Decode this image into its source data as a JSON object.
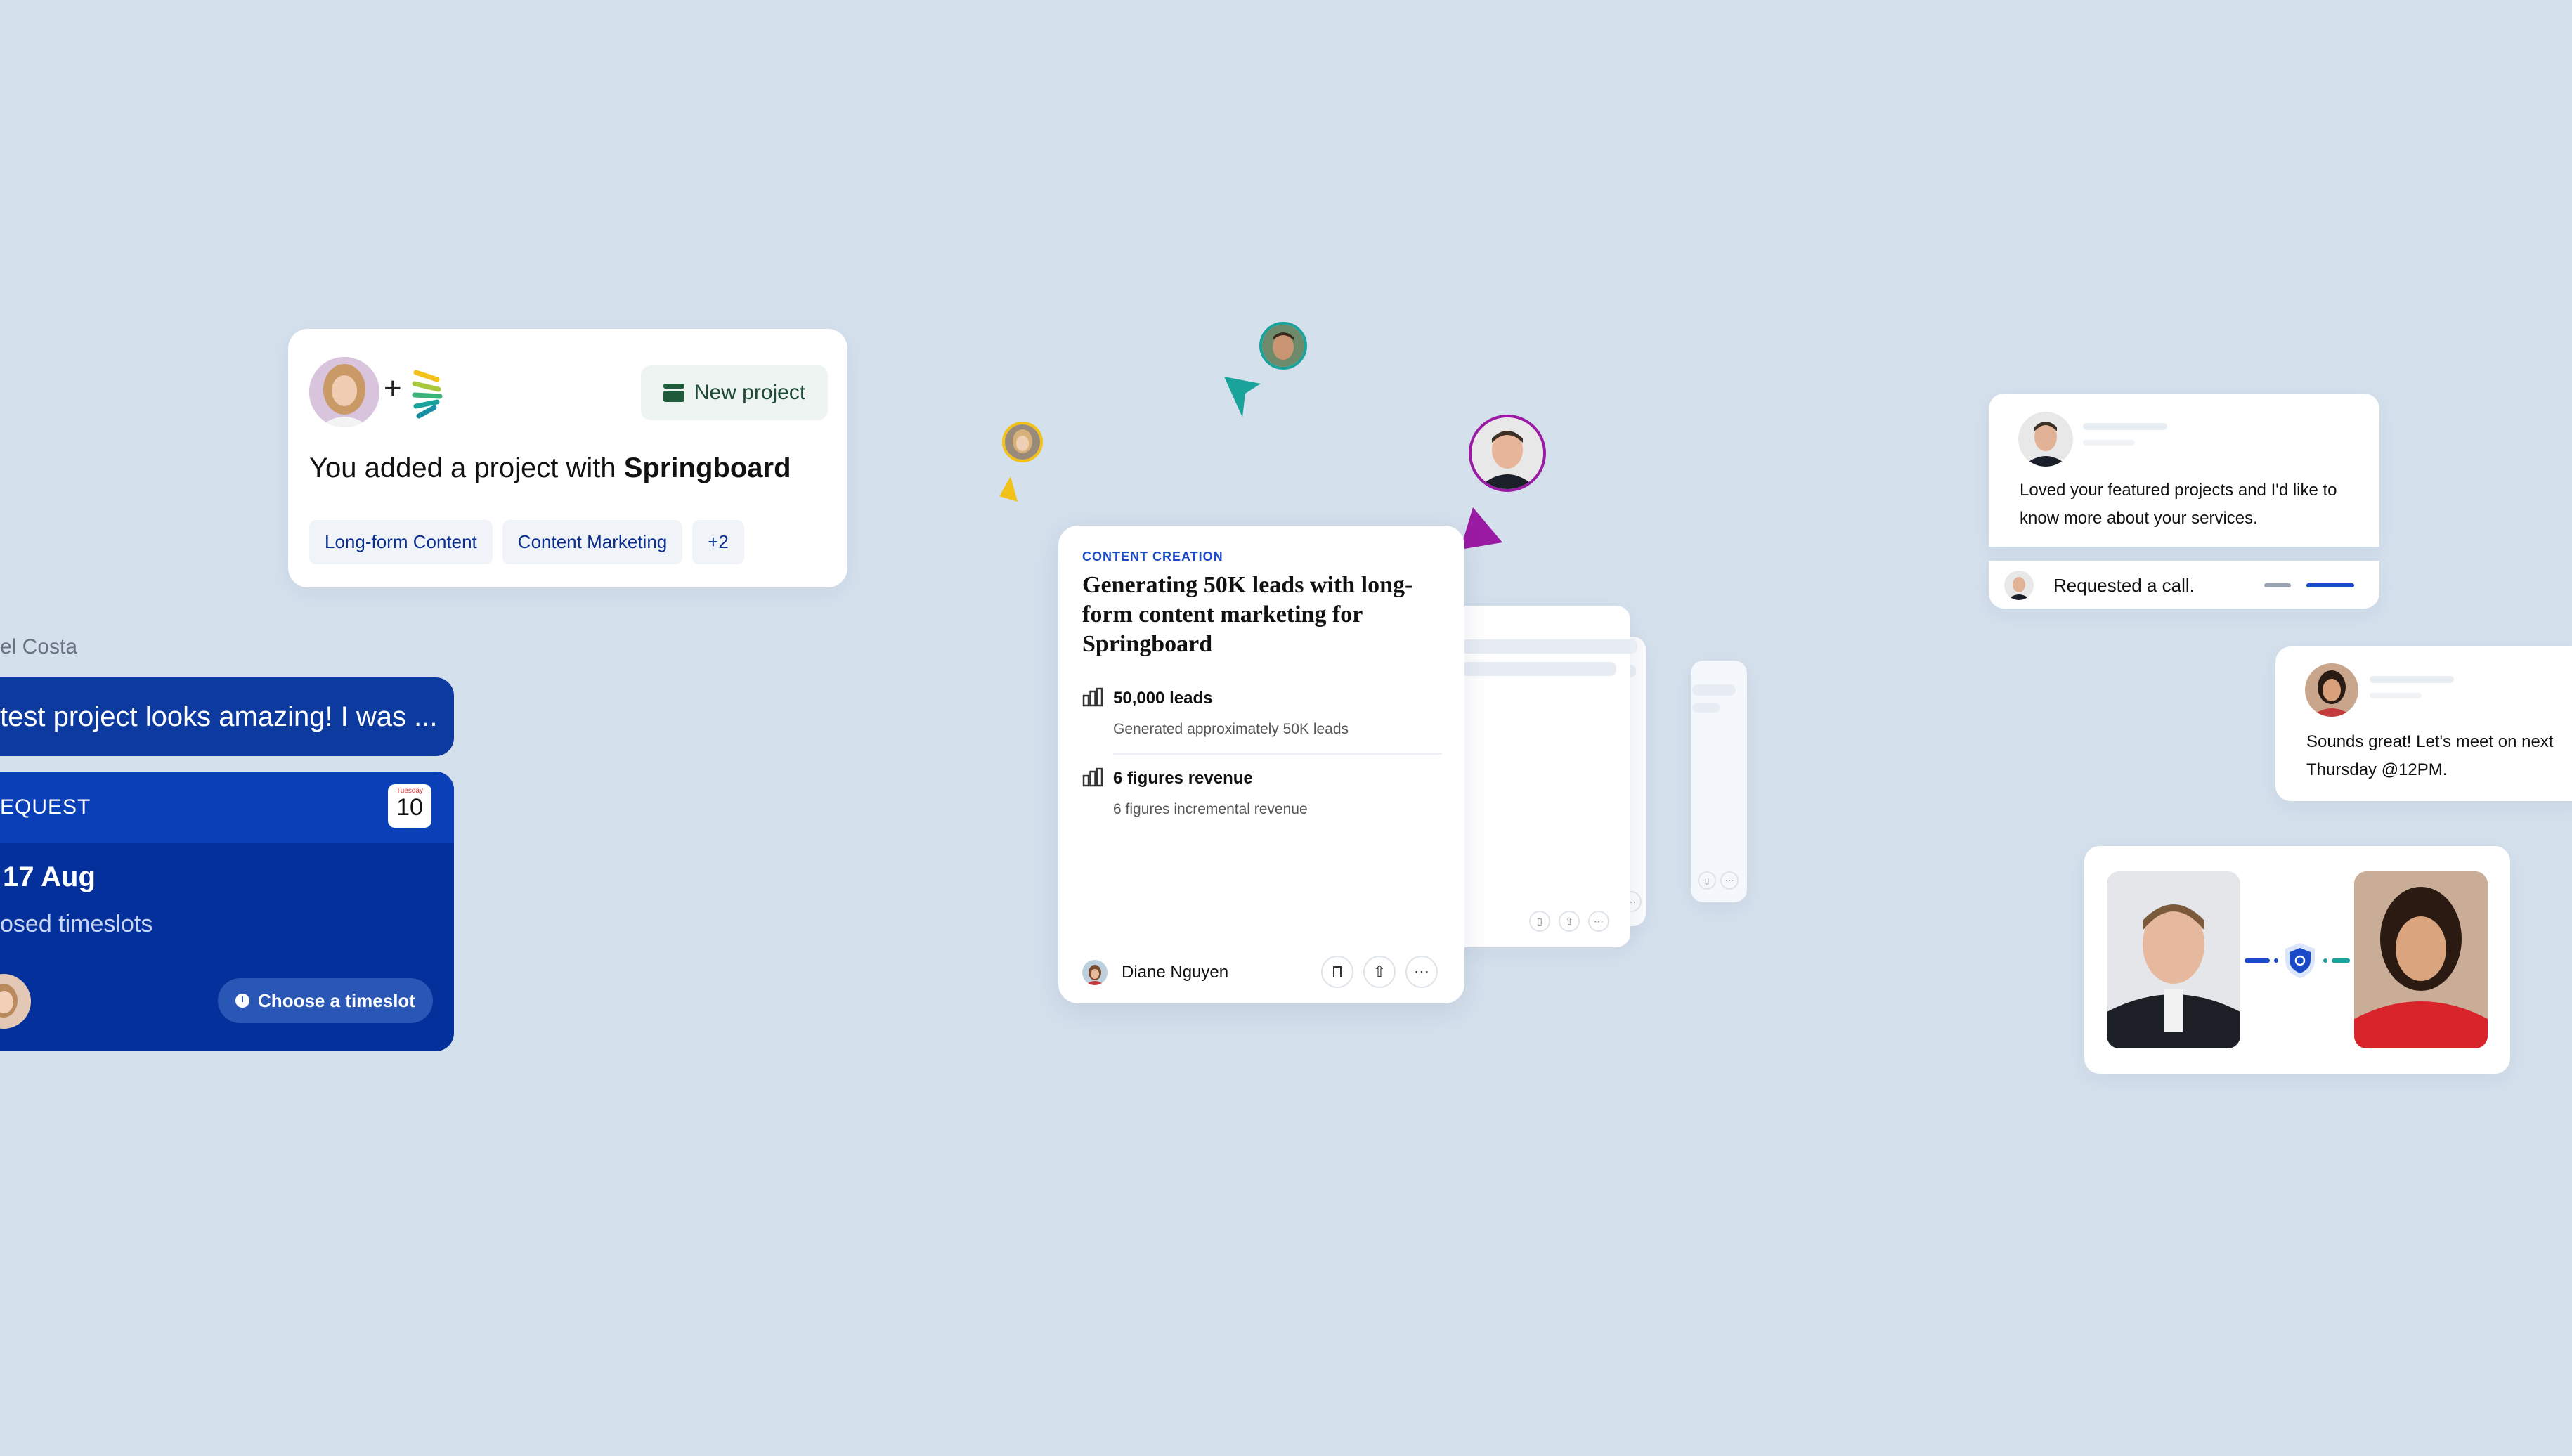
{
  "project_card": {
    "new_project_label": "New project",
    "message_prefix": "You added a project with ",
    "message_brand": "Springboard",
    "tags": [
      "Long-form Content",
      "Content Marketing",
      "+2"
    ]
  },
  "chat_left": {
    "sender_name": "el Costa",
    "message": "test project looks amazing! I was ...",
    "request_label": "EQUEST",
    "calendar_month": "Tuesday",
    "calendar_day": "10",
    "date": "17 Aug",
    "subtitle": "osed timeslots",
    "choose_button": "Choose a timeslot"
  },
  "case_study": {
    "category": "CONTENT CREATION",
    "title": "Generating 50K leads with long-form content marketing for Springboard",
    "metrics": [
      {
        "title": "50,000 leads",
        "desc": "Generated approximately 50K leads"
      },
      {
        "title": "6 figures revenue",
        "desc": "6 figures incremental revenue"
      }
    ],
    "author": "Diane Nguyen"
  },
  "message_right": {
    "text": "Loved your featured projects and I'd like to know more about your services.",
    "status": "Requested a call."
  },
  "reply_right": {
    "text_line1": "Sounds great! Let's meet on next",
    "text_line2": "Thursday @12PM."
  },
  "colors": {
    "background": "#d4e0ec",
    "navy": "#0a2f8f",
    "blue_bubble": "#0d3a9e",
    "purple": "#9b1aa3",
    "teal": "#1aa39a",
    "yellow": "#f2c21a",
    "green_button": "#1f5a3a"
  }
}
